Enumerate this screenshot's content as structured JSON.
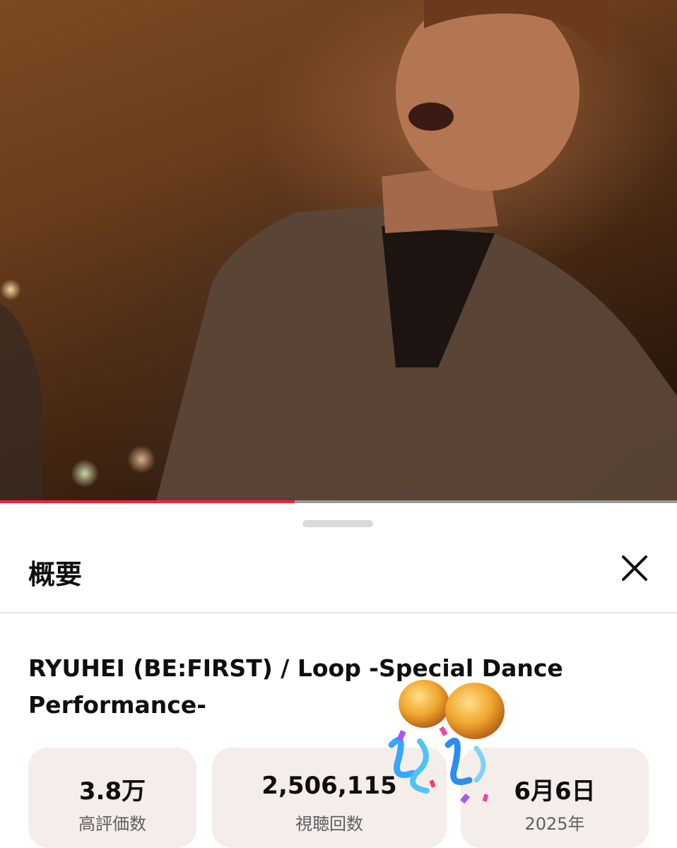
{
  "video": {
    "progress_fraction": 0.435,
    "colors": {
      "progress_played": "#f0233f",
      "progress_track": "#9a9a9a"
    }
  },
  "sheet": {
    "title": "概要",
    "close_icon": "close-icon",
    "video_title": "RYUHEI (BE:FIRST) / Loop -Special Dance Performance-",
    "stats": [
      {
        "value": "3.8万",
        "label": "高評価数"
      },
      {
        "value": "2,506,115",
        "label": "視聴回数"
      },
      {
        "value": "6月6日",
        "label": "2025年"
      }
    ],
    "colors": {
      "stat_bg": "#f5ede9",
      "text": "#0f0f0f",
      "muted": "#606060"
    }
  },
  "overlay": {
    "sticker_icon": "party-popper-sticker-icon"
  }
}
